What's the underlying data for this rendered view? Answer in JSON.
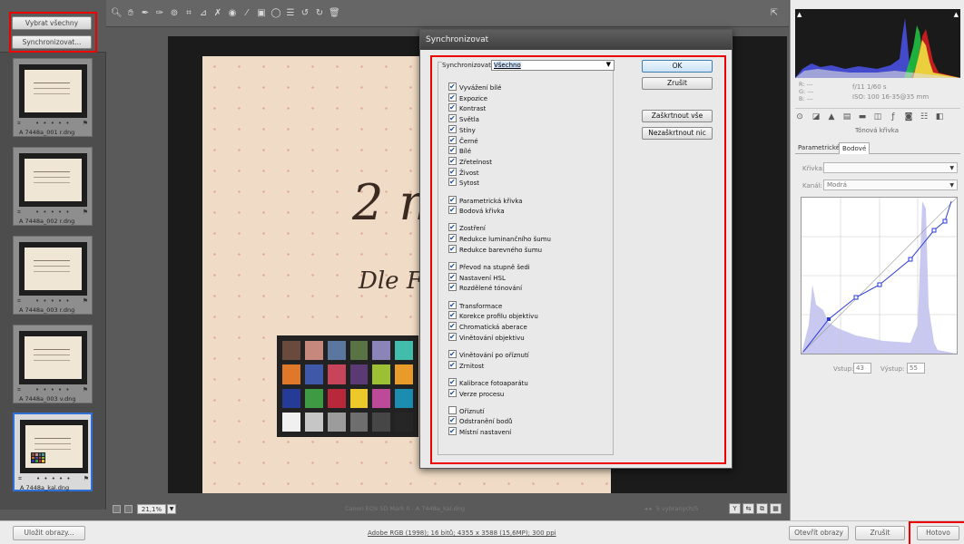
{
  "filmstrip": {
    "select_all_label": "Vybrat všechny",
    "synchronize_label": "Synchronizovat...",
    "stars": "• • • • •",
    "items": [
      {
        "label": "A 7448a_001 r.dng"
      },
      {
        "label": "A 7448a_002 r.dng"
      },
      {
        "label": "A 7448a_003 r.dng"
      },
      {
        "label": "A 7448a_003 v.dng"
      },
      {
        "label": "A 7448a_kal.dng"
      }
    ]
  },
  "preview": {
    "zoom": "21,1%",
    "camera_info": "Canon EOS 5D Mark II  -  A 7448a_kal.dng",
    "nav_info": "5 vybraných/5",
    "handwriting_1": "2 m",
    "handwriting_2": "Dle  F.",
    "handwriting_3": "\""
  },
  "histogram": {
    "readout_rgb_labels": [
      "R:",
      "G:",
      "B:"
    ],
    "readout_rgb_values": [
      "---",
      "---",
      "---"
    ],
    "aperture_shutter": "f/11   1/60 s",
    "iso_lens": "ISO: 100   16-35@35 mm"
  },
  "right_panel": {
    "title": "Tónová křivka",
    "tabs": [
      "Parametrické",
      "Bodové"
    ],
    "curve_label": "Křivka:",
    "curve_value": "",
    "channel_label": "Kanál:",
    "channel_value": "Modrá",
    "input_label": "Vstup:",
    "input_value": "43",
    "output_label": "Výstup:",
    "output_value": "55"
  },
  "dialog": {
    "title": "Synchronizovat",
    "sync_label": "Synchronizovat:",
    "sync_value": "Všechno",
    "ok_label": "OK",
    "cancel_label": "Zrušit",
    "check_all_label": "Zaškrtnout vše",
    "uncheck_all_label": "Nezaškrtnout nic",
    "options": [
      {
        "label": "Vyvážení bílé",
        "checked": true
      },
      {
        "label": "Expozice",
        "checked": true
      },
      {
        "label": "Kontrast",
        "checked": true
      },
      {
        "label": "Světla",
        "checked": true
      },
      {
        "label": "Stíny",
        "checked": true
      },
      {
        "label": "Černé",
        "checked": true
      },
      {
        "label": "Bílé",
        "checked": true
      },
      {
        "label": "Zřetelnost",
        "checked": true
      },
      {
        "label": "Živost",
        "checked": true
      },
      {
        "label": "Sytost",
        "checked": true
      },
      {
        "label": "Parametrická křivka",
        "checked": true
      },
      {
        "label": "Bodová křivka",
        "checked": true
      },
      {
        "label": "Zostření",
        "checked": true
      },
      {
        "label": "Redukce luminančního šumu",
        "checked": true
      },
      {
        "label": "Redukce barevného šumu",
        "checked": true
      },
      {
        "label": "Převod na stupně šedi",
        "checked": true
      },
      {
        "label": "Nastavení HSL",
        "checked": true
      },
      {
        "label": "Rozdělené tónování",
        "checked": true
      },
      {
        "label": "Transformace",
        "checked": true
      },
      {
        "label": "Korekce profilu objektivu",
        "checked": true
      },
      {
        "label": "Chromatická aberace",
        "checked": true
      },
      {
        "label": "Vinětování objektivu",
        "checked": true
      },
      {
        "label": "Vinětování po oříznutí",
        "checked": true
      },
      {
        "label": "Zrnitost",
        "checked": true
      },
      {
        "label": "Kalibrace fotoaparátu",
        "checked": true
      },
      {
        "label": "Verze procesu",
        "checked": true
      },
      {
        "label": "Oříznutí",
        "checked": false
      },
      {
        "label": "Odstranění bodů",
        "checked": true
      },
      {
        "label": "Místní nastavení",
        "checked": true
      }
    ]
  },
  "bottom_bar": {
    "save_label": "Uložit obrazy...",
    "workflow_info": "Adobe RGB (1998); 16 bitů; 4355 x 3588 (15,6MP); 300 ppi",
    "open_label": "Otevřít obrazy",
    "cancel_label": "Zrušit",
    "done_label": "Hotovo"
  },
  "colors": {
    "highlight_frame": "#e00000",
    "selection_blue": "#2e6fd8",
    "ok_button_border": "#3c7fb1"
  }
}
